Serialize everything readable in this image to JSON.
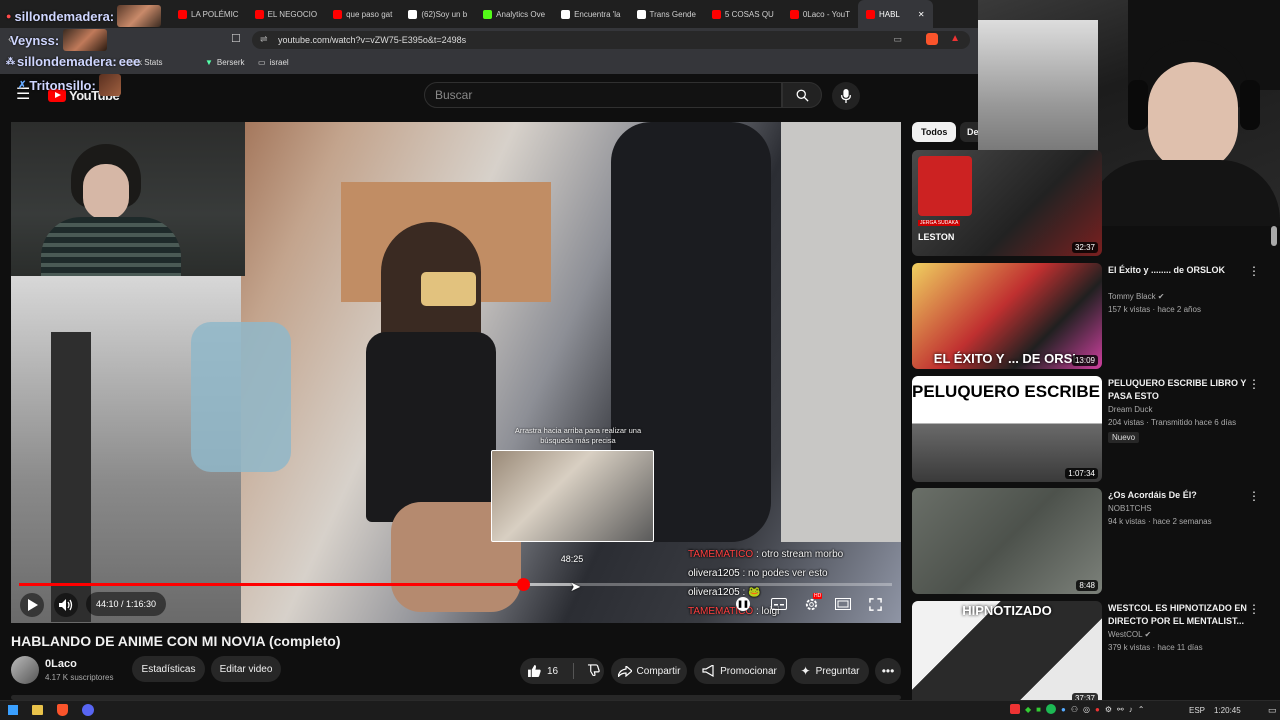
{
  "browser": {
    "tabs": [
      {
        "label": "LA POLÉMIC",
        "color": "#ff0000"
      },
      {
        "label": "EL NEGOCIO",
        "color": "#ff0000"
      },
      {
        "label": "que paso gat",
        "color": "#ff0000"
      },
      {
        "label": "(62)Soy un b",
        "color": "#ffffff"
      },
      {
        "label": "Analytics Ove",
        "color": "#53fc18"
      },
      {
        "label": "Encuentra 'la",
        "color": "#ffffff"
      },
      {
        "label": "Trans Gende",
        "color": "#ffffff"
      },
      {
        "label": "5 COSAS QU",
        "color": "#ff0000"
      },
      {
        "label": "0Laco - YouT",
        "color": "#ff0000"
      },
      {
        "label": "HABL",
        "color": "#ff0000"
      }
    ],
    "url": "youtube.com/watch?v=vZW75-E395o&t=2498s",
    "bookmarks": [
      "Kick Stats",
      "Berserk",
      "israel"
    ]
  },
  "overlay_names": {
    "name1": "sillondemadera:",
    "name2": "Veynss:",
    "name3": "sillondemadera:",
    "name3_suffix": "eee",
    "name4": "Tritonsillo:"
  },
  "youtube": {
    "logo": "YouTube",
    "search_placeholder": "Buscar"
  },
  "video": {
    "title": "HABLANDO DE ANIME CON MI NOVIA (completo)",
    "time_current": "44:10",
    "time_total": "1:16:30",
    "time_display": "44:10 / 1:16:30",
    "hover_time": "48:25",
    "hover_hint": "Arrastra hacia arriba para realizar una búsqueda más precisa",
    "progress_fraction": 0.577,
    "hover_fraction": 0.633,
    "chat": [
      {
        "user": "TAMEMATICO",
        "msg": " : otro stream morbo",
        "color": "#ff4040"
      },
      {
        "user": "olivera1205",
        "msg": " : no podes ver esto",
        "color": "#ffffff"
      },
      {
        "user": "olivera1205",
        "msg": " : 🐸",
        "color": "#ffffff"
      },
      {
        "user": "TAMEMATICO",
        "msg": " : loigi",
        "color": "#ff4040"
      }
    ]
  },
  "channel": {
    "name": "0Laco",
    "subs": "4.17 K suscriptores",
    "stats_btn": "Estadísticas",
    "edit_btn": "Editar video"
  },
  "actions": {
    "likes": "16",
    "share": "Compartir",
    "promote": "Promocionar",
    "ask": "Preguntar"
  },
  "sidebar": {
    "chips": [
      "Todos",
      "De"
    ],
    "top_thumb_label": "LESTON",
    "top_thumb_badge": "JERGA SUDAKA",
    "top_thumb_duration": "32:37",
    "items": [
      {
        "title": "El Éxito y ........ de ORSLOK",
        "channel": "Tommy Black",
        "verified": true,
        "meta": "157 k vistas · hace 2 años",
        "duration": "13:09",
        "badge": "",
        "thumb_text": "EL ÉXITO Y ... DE ORSL"
      },
      {
        "title": "PELUQUERO ESCRIBE LIBRO Y PASA ESTO",
        "channel": "Dream Duck",
        "verified": false,
        "meta": "204 vistas · Transmitido hace 6 días",
        "duration": "1:07:34",
        "badge": "Nuevo",
        "thumb_text": "PELUQUERO ESCRIBE LIBRO"
      },
      {
        "title": "¿Os Acordáis De ÉI?",
        "channel": "NOB1TCHS",
        "verified": false,
        "meta": "94 k vistas · hace 2 semanas",
        "duration": "8:48",
        "badge": "",
        "thumb_text": ""
      },
      {
        "title": "WESTCOL ES HIPNOTIZADO EN DIRECTO POR EL MENTALIST...",
        "channel": "WestCOL",
        "verified": true,
        "meta": "379 k vistas · hace 11 días",
        "duration": "37:37",
        "badge": "",
        "thumb_text": "HIPNOTIZADO"
      }
    ]
  },
  "taskbar": {
    "lang": "ESP",
    "clock": "1:20:45"
  },
  "colors": {
    "accent": "#ff0000",
    "bg": "#0f0f0f",
    "pill": "#272727"
  }
}
